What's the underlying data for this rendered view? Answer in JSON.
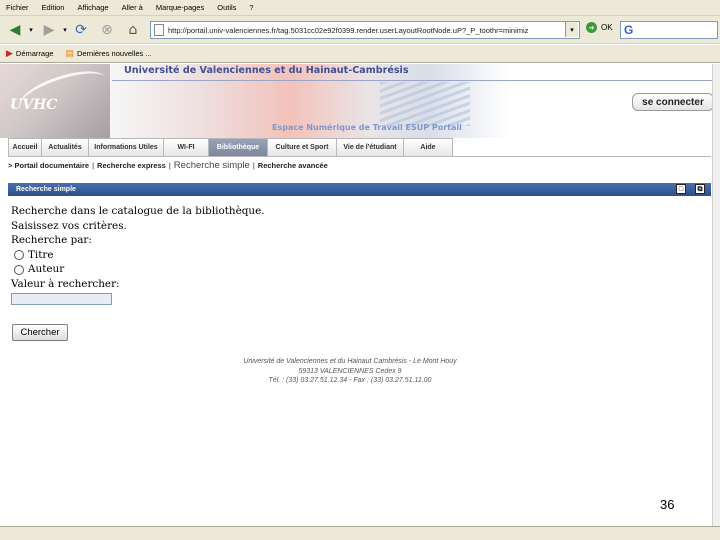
{
  "browser": {
    "menu": [
      "Fichier",
      "Edition",
      "Affichage",
      "Aller à",
      "Marque-pages",
      "Outils",
      "?"
    ],
    "url": "http://portail.univ-valenciennes.fr/tag.5031cc02e92f0399.render.userLayoutRootNode.uP?_P_toothr=minimiz",
    "go_label": "OK",
    "search_value": "G",
    "bookmarks": [
      "Démarrage",
      "Dernières nouvelles ..."
    ]
  },
  "banner": {
    "logo": "UVHC",
    "university": "Université de Valenciennes et du Hainaut-Cambrésis",
    "ent_title": "Espace Numérique de Travail ESUP Portail",
    "connect_label": "se connecter"
  },
  "tabs": [
    "Accueil",
    "Actualités",
    "Informations Utiles",
    "WI-FI",
    "Bibliothèque",
    "Culture et Sport",
    "Vie de l'étudiant",
    "Aide"
  ],
  "subnav": {
    "prefix": ">",
    "items": [
      "Portail documentaire",
      "Recherche express",
      "Recherche simple",
      "Recherche avancée"
    ],
    "separator": "|"
  },
  "panel": {
    "title": "Recherche simple",
    "min_icon": "□",
    "max_icon": "⧉"
  },
  "form": {
    "intro": "Recherche dans le catalogue de la bibliothèque.",
    "criteria": "Saisissez vos critères.",
    "search_by": "Recherche par:",
    "option_title": "Titre",
    "option_author": "Auteur",
    "value_label": "Valeur à rechercher:",
    "submit_label": "Chercher"
  },
  "footer": {
    "line1": "Université de Valenciennes et du Hainaut Cambrésis - Le Mont Houy",
    "line2": "59313 VALENCIENNES Cedex 9",
    "line3": "Tél. : (33) 03.27.51.12.34 - Fax : (33) 03.27.51.11.00"
  },
  "slide_number": "36"
}
